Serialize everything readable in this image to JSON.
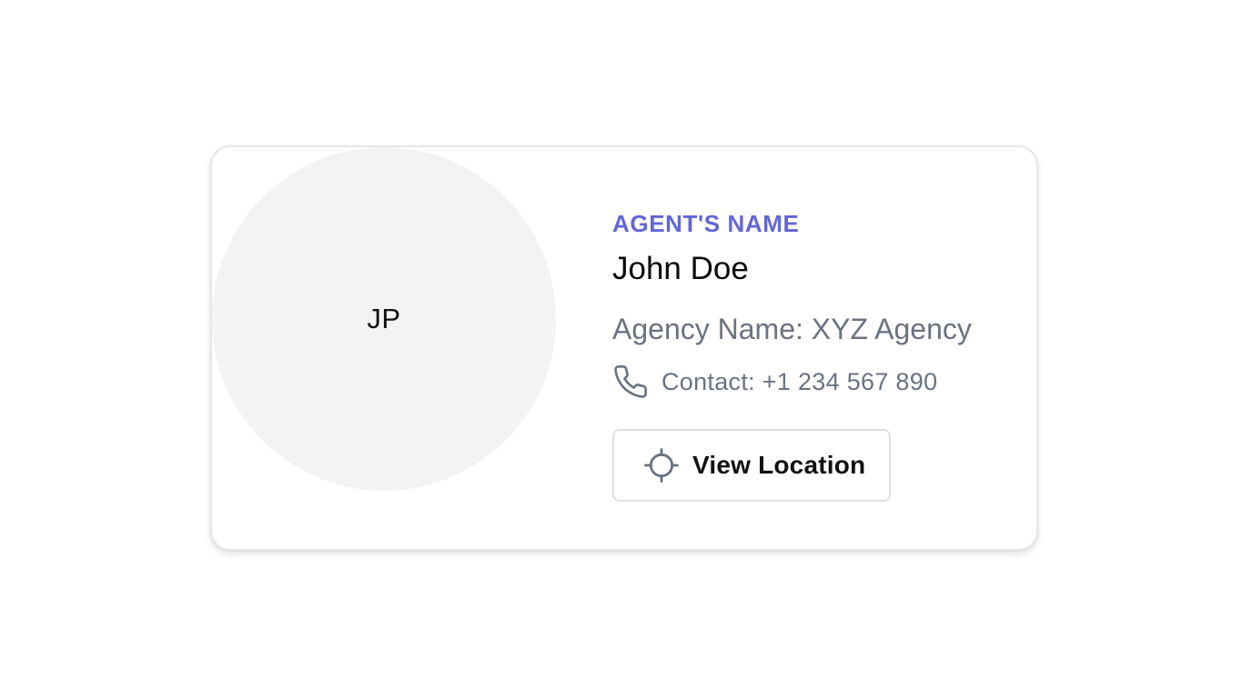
{
  "agent_card": {
    "avatar": {
      "initials": "JP"
    },
    "label": "AGENT'S NAME",
    "name": "John Doe",
    "agency": "Agency Name: XYZ Agency",
    "contact": "Contact: +1 234 567 890",
    "view_location_label": "View Location",
    "icons": {
      "phone": "phone-icon",
      "location": "crosshair-icon"
    },
    "colors": {
      "accent": "#6366d8",
      "muted_text": "#6b7280",
      "avatar_bg": "#f3f3f3",
      "border": "#e5e7eb"
    }
  }
}
